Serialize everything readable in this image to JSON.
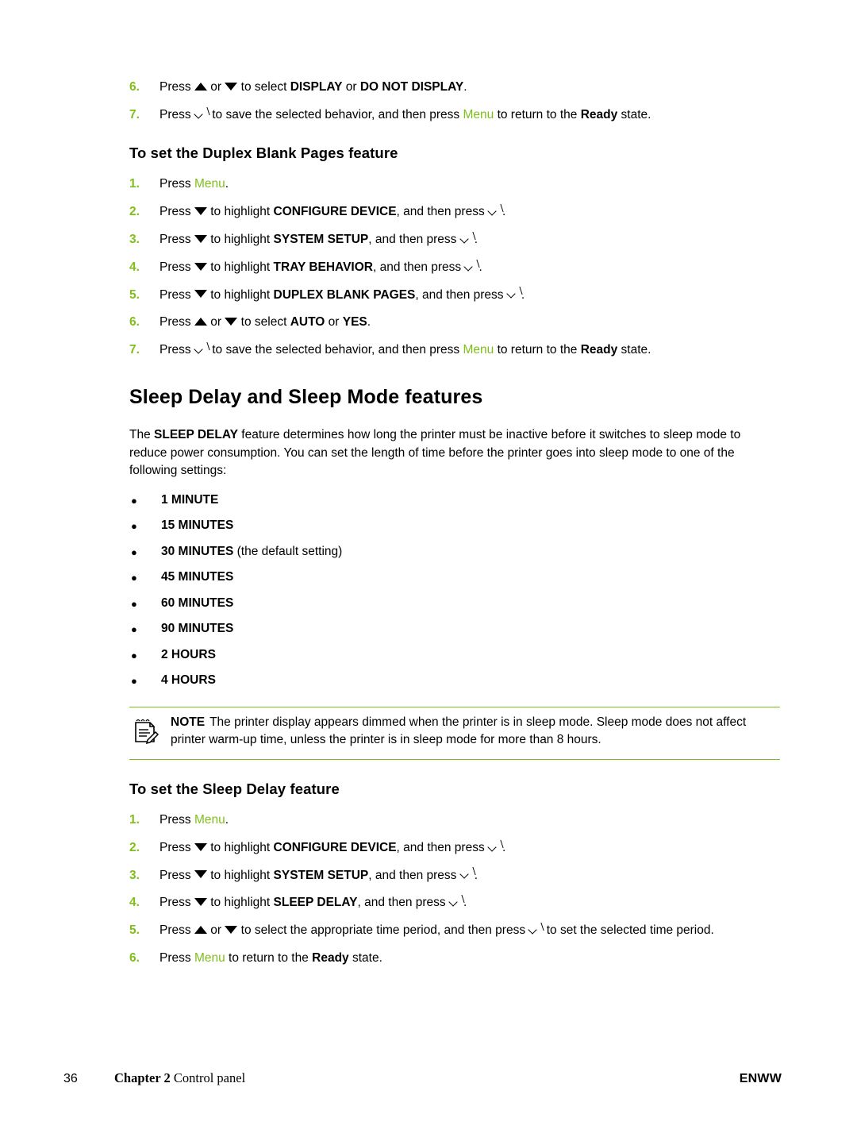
{
  "top_steps": [
    {
      "num": "6.",
      "parts": [
        {
          "t": "Press ",
          "s": "plain"
        },
        {
          "t": "",
          "s": "arrow-up"
        },
        {
          "t": " or ",
          "s": "plain"
        },
        {
          "t": "",
          "s": "arrow-down"
        },
        {
          "t": " to select ",
          "s": "plain"
        },
        {
          "t": "DISPLAY",
          "s": "bold"
        },
        {
          "t": " or ",
          "s": "plain"
        },
        {
          "t": "DO NOT DISPLAY",
          "s": "bold"
        },
        {
          "t": ".",
          "s": "plain"
        }
      ]
    },
    {
      "num": "7.",
      "parts": [
        {
          "t": "Press ",
          "s": "plain"
        },
        {
          "t": "",
          "s": "check"
        },
        {
          "t": " to save the selected behavior, and then press ",
          "s": "plain"
        },
        {
          "t": "Menu",
          "s": "menu"
        },
        {
          "t": " to return to the ",
          "s": "plain"
        },
        {
          "t": "Ready",
          "s": "bold"
        },
        {
          "t": " state.",
          "s": "plain"
        }
      ]
    }
  ],
  "duplex_heading": "To set the Duplex Blank Pages feature",
  "duplex_steps": [
    {
      "num": "1.",
      "parts": [
        {
          "t": "Press ",
          "s": "plain"
        },
        {
          "t": "Menu",
          "s": "menu"
        },
        {
          "t": ".",
          "s": "plain"
        }
      ]
    },
    {
      "num": "2.",
      "parts": [
        {
          "t": "Press ",
          "s": "plain"
        },
        {
          "t": "",
          "s": "arrow-down"
        },
        {
          "t": " to highlight ",
          "s": "plain"
        },
        {
          "t": "CONFIGURE DEVICE",
          "s": "bold"
        },
        {
          "t": ", and then press ",
          "s": "plain"
        },
        {
          "t": "",
          "s": "check"
        },
        {
          "t": ".",
          "s": "plain"
        }
      ]
    },
    {
      "num": "3.",
      "parts": [
        {
          "t": "Press ",
          "s": "plain"
        },
        {
          "t": "",
          "s": "arrow-down"
        },
        {
          "t": " to highlight ",
          "s": "plain"
        },
        {
          "t": "SYSTEM SETUP",
          "s": "bold"
        },
        {
          "t": ", and then press ",
          "s": "plain"
        },
        {
          "t": "",
          "s": "check"
        },
        {
          "t": ".",
          "s": "plain"
        }
      ]
    },
    {
      "num": "4.",
      "parts": [
        {
          "t": "Press ",
          "s": "plain"
        },
        {
          "t": "",
          "s": "arrow-down"
        },
        {
          "t": " to highlight ",
          "s": "plain"
        },
        {
          "t": "TRAY BEHAVIOR",
          "s": "bold"
        },
        {
          "t": ", and then press ",
          "s": "plain"
        },
        {
          "t": "",
          "s": "check"
        },
        {
          "t": ".",
          "s": "plain"
        }
      ]
    },
    {
      "num": "5.",
      "parts": [
        {
          "t": "Press ",
          "s": "plain"
        },
        {
          "t": "",
          "s": "arrow-down"
        },
        {
          "t": " to highlight ",
          "s": "plain"
        },
        {
          "t": "DUPLEX BLANK PAGES",
          "s": "bold"
        },
        {
          "t": ", and then press ",
          "s": "plain"
        },
        {
          "t": "",
          "s": "check"
        },
        {
          "t": ".",
          "s": "plain"
        }
      ]
    },
    {
      "num": "6.",
      "parts": [
        {
          "t": "Press ",
          "s": "plain"
        },
        {
          "t": "",
          "s": "arrow-up"
        },
        {
          "t": " or ",
          "s": "plain"
        },
        {
          "t": "",
          "s": "arrow-down"
        },
        {
          "t": " to select ",
          "s": "plain"
        },
        {
          "t": "AUTO",
          "s": "bold"
        },
        {
          "t": " or ",
          "s": "plain"
        },
        {
          "t": "YES",
          "s": "bold"
        },
        {
          "t": ".",
          "s": "plain"
        }
      ]
    },
    {
      "num": "7.",
      "parts": [
        {
          "t": "Press ",
          "s": "plain"
        },
        {
          "t": "",
          "s": "check"
        },
        {
          "t": " to save the selected behavior, and then press ",
          "s": "plain"
        },
        {
          "t": "Menu",
          "s": "menu"
        },
        {
          "t": " to return to the ",
          "s": "plain"
        },
        {
          "t": "Ready",
          "s": "bold"
        },
        {
          "t": " state.",
          "s": "plain"
        }
      ]
    }
  ],
  "sleep_heading": "Sleep Delay and Sleep Mode features",
  "sleep_intro": [
    {
      "t": "The ",
      "s": "plain"
    },
    {
      "t": "SLEEP DELAY",
      "s": "bold"
    },
    {
      "t": " feature determines how long the printer must be inactive before it switches to sleep mode to reduce power consumption. You can set the length of time before the printer goes into sleep mode to one of the following settings:",
      "s": "plain"
    }
  ],
  "sleep_options": [
    {
      "bold": "1 MINUTE",
      "rest": ""
    },
    {
      "bold": "15 MINUTES",
      "rest": ""
    },
    {
      "bold": "30 MINUTES",
      "rest": " (the default setting)"
    },
    {
      "bold": "45 MINUTES",
      "rest": ""
    },
    {
      "bold": "60 MINUTES",
      "rest": ""
    },
    {
      "bold": "90 MINUTES",
      "rest": ""
    },
    {
      "bold": "2 HOURS",
      "rest": ""
    },
    {
      "bold": "4 HOURS",
      "rest": ""
    }
  ],
  "note": {
    "label": "NOTE",
    "text": "The printer display appears dimmed when the printer is in sleep mode. Sleep mode does not affect printer warm-up time, unless the printer is in sleep mode for more than 8 hours.",
    "icon": "note-pad-icon",
    "rule_color": "#7fbf1a"
  },
  "sleepdelay_heading": "To set the Sleep Delay feature",
  "sleepdelay_steps": [
    {
      "num": "1.",
      "parts": [
        {
          "t": "Press ",
          "s": "plain"
        },
        {
          "t": "Menu",
          "s": "menu"
        },
        {
          "t": ".",
          "s": "plain"
        }
      ]
    },
    {
      "num": "2.",
      "parts": [
        {
          "t": "Press ",
          "s": "plain"
        },
        {
          "t": "",
          "s": "arrow-down"
        },
        {
          "t": " to highlight ",
          "s": "plain"
        },
        {
          "t": "CONFIGURE DEVICE",
          "s": "bold"
        },
        {
          "t": ", and then press ",
          "s": "plain"
        },
        {
          "t": "",
          "s": "check"
        },
        {
          "t": ".",
          "s": "plain"
        }
      ]
    },
    {
      "num": "3.",
      "parts": [
        {
          "t": "Press ",
          "s": "plain"
        },
        {
          "t": "",
          "s": "arrow-down"
        },
        {
          "t": " to highlight ",
          "s": "plain"
        },
        {
          "t": "SYSTEM SETUP",
          "s": "bold"
        },
        {
          "t": ", and then press ",
          "s": "plain"
        },
        {
          "t": "",
          "s": "check"
        },
        {
          "t": ".",
          "s": "plain"
        }
      ]
    },
    {
      "num": "4.",
      "parts": [
        {
          "t": "Press ",
          "s": "plain"
        },
        {
          "t": "",
          "s": "arrow-down"
        },
        {
          "t": " to highlight ",
          "s": "plain"
        },
        {
          "t": "SLEEP DELAY",
          "s": "bold"
        },
        {
          "t": ", and then press ",
          "s": "plain"
        },
        {
          "t": "",
          "s": "check"
        },
        {
          "t": ".",
          "s": "plain"
        }
      ]
    },
    {
      "num": "5.",
      "parts": [
        {
          "t": "Press ",
          "s": "plain"
        },
        {
          "t": "",
          "s": "arrow-up"
        },
        {
          "t": " or ",
          "s": "plain"
        },
        {
          "t": "",
          "s": "arrow-down"
        },
        {
          "t": " to select the appropriate time period, and then press ",
          "s": "plain"
        },
        {
          "t": "",
          "s": "check"
        },
        {
          "t": " to set the selected time period.",
          "s": "plain"
        }
      ]
    },
    {
      "num": "6.",
      "parts": [
        {
          "t": "Press ",
          "s": "plain"
        },
        {
          "t": "Menu",
          "s": "menu"
        },
        {
          "t": " to return to the ",
          "s": "plain"
        },
        {
          "t": "Ready",
          "s": "bold"
        },
        {
          "t": " state.",
          "s": "plain"
        }
      ]
    }
  ],
  "footer": {
    "page_number": "36",
    "chapter_label": "Chapter 2",
    "chapter_title": "Control panel",
    "right": "ENWW"
  },
  "colors": {
    "accent_green": "#7fbf1a",
    "text": "#000000"
  }
}
